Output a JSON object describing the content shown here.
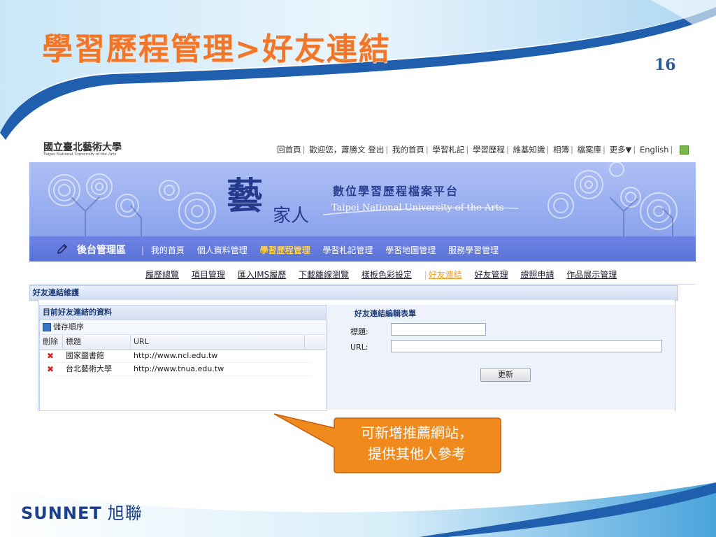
{
  "slide": {
    "title": "學習歷程管理>好友連結",
    "page_number": "16",
    "callout": {
      "line1": "可新增推薦網站，",
      "line2": "提供其他人參考"
    },
    "brand_en": "SUNNET",
    "brand_cn": "旭聯"
  },
  "app": {
    "logo_cn": "國立臺北藝術大學",
    "logo_en": "Taipei National University of the Arts",
    "top_links": [
      "回首頁",
      "歡迎您，蕭勝文 登出",
      "我的首頁",
      "學習札記",
      "學習歷程",
      "維基知識",
      "相簿",
      "檔案庫",
      "更多▼",
      "English"
    ],
    "banner": {
      "calligraphy_main": "藝",
      "calligraphy_sub": "家人",
      "title_cn": "數位學習歷程檔案平台",
      "title_en": "Taipei National University of the Arts"
    },
    "nav": {
      "admin_label": "後台管理區",
      "items": [
        {
          "label": "我的首頁",
          "active": false
        },
        {
          "label": "個人資料管理",
          "active": false
        },
        {
          "label": "學習歷程管理",
          "active": true
        },
        {
          "label": "學習札記管理",
          "active": false
        },
        {
          "label": "學習地圖管理",
          "active": false
        },
        {
          "label": "服務學習管理",
          "active": false
        }
      ]
    },
    "subnav": [
      {
        "label": "履歷總覽",
        "active": false
      },
      {
        "label": "項目管理",
        "active": false
      },
      {
        "label": "匯入IMS履歷",
        "active": false
      },
      {
        "label": "下載離線瀏覽",
        "active": false
      },
      {
        "label": "樣板色彩設定",
        "active": false
      },
      {
        "label": "好友連結",
        "active": true
      },
      {
        "label": "好友管理",
        "active": false
      },
      {
        "label": "證照申請",
        "active": false
      },
      {
        "label": "作品展示管理",
        "active": false
      }
    ],
    "panel_title": "好友連結維護",
    "list_panel": {
      "header": "目前好友連結的資料",
      "save_order": "儲存順序",
      "columns": [
        "刪除",
        "標題",
        "URL"
      ],
      "rows": [
        {
          "title": "國家圖書館",
          "url": "http://www.ncl.edu.tw"
        },
        {
          "title": "台北藝術大學",
          "url": "http://www.tnua.edu.tw"
        }
      ]
    },
    "form": {
      "title": "好友連結編輯表單",
      "title_label": "標題:",
      "url_label": "URL:",
      "title_value": "",
      "url_value": "",
      "update_button": "更新"
    }
  },
  "colors": {
    "title_orange": "#f2762a",
    "nav_blue": "#5a72d8",
    "callout_orange": "#f08a1c",
    "brand_blue": "#1a3f8c"
  }
}
